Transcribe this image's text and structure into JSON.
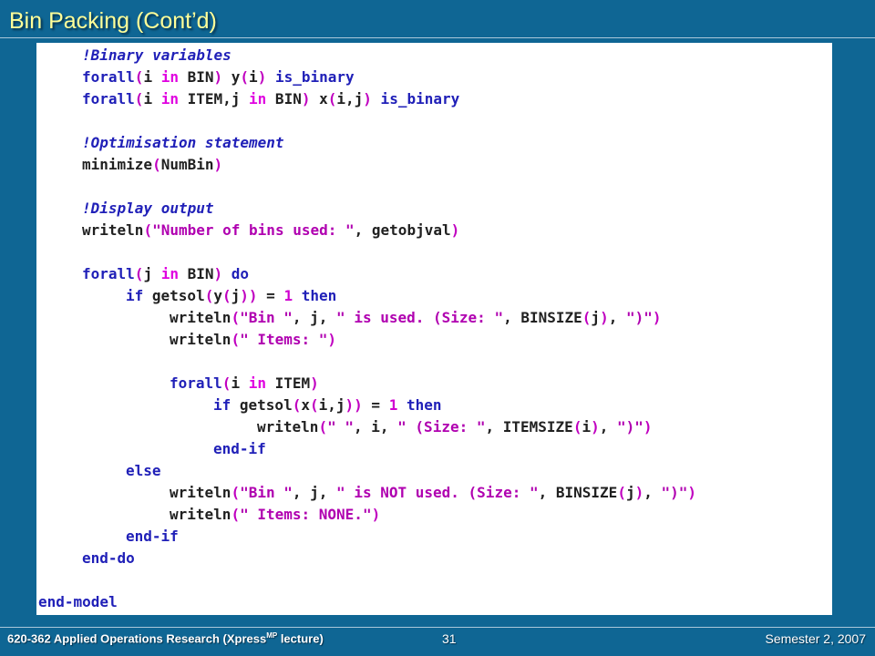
{
  "slide": {
    "title": "Bin Packing (Cont’d)",
    "footer_course_prefix": "620-362 Applied Operations Research (Xpress",
    "footer_course_sup": "MP",
    "footer_course_suffix": " lecture)",
    "page_number": "31",
    "semester": "Semester 2, 2007"
  },
  "code_lines": [
    {
      "indent": 1,
      "tokens": [
        {
          "t": "!Binary variables",
          "c": "com"
        }
      ]
    },
    {
      "indent": 1,
      "tokens": [
        {
          "t": "forall",
          "c": "kw"
        },
        {
          "t": "(",
          "c": "par"
        },
        {
          "t": "i ",
          "c": "id"
        },
        {
          "t": "in",
          "c": "in"
        },
        {
          "t": " BIN",
          "c": "id"
        },
        {
          "t": ")",
          "c": "par"
        },
        {
          "t": " y",
          "c": "id"
        },
        {
          "t": "(",
          "c": "par"
        },
        {
          "t": "i",
          "c": "id"
        },
        {
          "t": ")",
          "c": "par"
        },
        {
          "t": " is_binary",
          "c": "kw"
        }
      ]
    },
    {
      "indent": 1,
      "tokens": [
        {
          "t": "forall",
          "c": "kw"
        },
        {
          "t": "(",
          "c": "par"
        },
        {
          "t": "i ",
          "c": "id"
        },
        {
          "t": "in",
          "c": "in"
        },
        {
          "t": " ITEM,j ",
          "c": "id"
        },
        {
          "t": "in",
          "c": "in"
        },
        {
          "t": " BIN",
          "c": "id"
        },
        {
          "t": ")",
          "c": "par"
        },
        {
          "t": " x",
          "c": "id"
        },
        {
          "t": "(",
          "c": "par"
        },
        {
          "t": "i,j",
          "c": "id"
        },
        {
          "t": ")",
          "c": "par"
        },
        {
          "t": " is_binary",
          "c": "kw"
        }
      ]
    },
    {
      "indent": 0,
      "tokens": []
    },
    {
      "indent": 1,
      "tokens": [
        {
          "t": "!Optimisation statement",
          "c": "com"
        }
      ]
    },
    {
      "indent": 1,
      "tokens": [
        {
          "t": "minimize",
          "c": "id"
        },
        {
          "t": "(",
          "c": "par"
        },
        {
          "t": "NumBin",
          "c": "id"
        },
        {
          "t": ")",
          "c": "par"
        }
      ]
    },
    {
      "indent": 0,
      "tokens": []
    },
    {
      "indent": 1,
      "tokens": [
        {
          "t": "!Display output",
          "c": "com"
        }
      ]
    },
    {
      "indent": 1,
      "tokens": [
        {
          "t": "writeln",
          "c": "id"
        },
        {
          "t": "(",
          "c": "par"
        },
        {
          "t": "\"Number of bins used: \"",
          "c": "str"
        },
        {
          "t": ", getobjval",
          "c": "id"
        },
        {
          "t": ")",
          "c": "par"
        }
      ]
    },
    {
      "indent": 0,
      "tokens": []
    },
    {
      "indent": 1,
      "tokens": [
        {
          "t": "forall",
          "c": "kw"
        },
        {
          "t": "(",
          "c": "par"
        },
        {
          "t": "j ",
          "c": "id"
        },
        {
          "t": "in",
          "c": "in"
        },
        {
          "t": " BIN",
          "c": "id"
        },
        {
          "t": ")",
          "c": "par"
        },
        {
          "t": " do",
          "c": "kw"
        }
      ]
    },
    {
      "indent": 2,
      "tokens": [
        {
          "t": "if",
          "c": "kw"
        },
        {
          "t": " getsol",
          "c": "id"
        },
        {
          "t": "(",
          "c": "par"
        },
        {
          "t": "y",
          "c": "id"
        },
        {
          "t": "(",
          "c": "par"
        },
        {
          "t": "j",
          "c": "id"
        },
        {
          "t": "))",
          "c": "par"
        },
        {
          "t": " = ",
          "c": "id"
        },
        {
          "t": "1",
          "c": "num"
        },
        {
          "t": " then",
          "c": "kw"
        }
      ]
    },
    {
      "indent": 3,
      "tokens": [
        {
          "t": "writeln",
          "c": "id"
        },
        {
          "t": "(",
          "c": "par"
        },
        {
          "t": "\"Bin \"",
          "c": "str"
        },
        {
          "t": ", j, ",
          "c": "id"
        },
        {
          "t": "\" is used. (Size: \"",
          "c": "str"
        },
        {
          "t": ", BINSIZE",
          "c": "id"
        },
        {
          "t": "(",
          "c": "par"
        },
        {
          "t": "j",
          "c": "id"
        },
        {
          "t": ")",
          "c": "par"
        },
        {
          "t": ", ",
          "c": "id"
        },
        {
          "t": "\")\"",
          "c": "str"
        },
        {
          "t": ")",
          "c": "par"
        }
      ]
    },
    {
      "indent": 3,
      "tokens": [
        {
          "t": "writeln",
          "c": "id"
        },
        {
          "t": "(",
          "c": "par"
        },
        {
          "t": "\" Items: \"",
          "c": "str"
        },
        {
          "t": ")",
          "c": "par"
        }
      ]
    },
    {
      "indent": 0,
      "tokens": []
    },
    {
      "indent": 3,
      "tokens": [
        {
          "t": "forall",
          "c": "kw"
        },
        {
          "t": "(",
          "c": "par"
        },
        {
          "t": "i ",
          "c": "id"
        },
        {
          "t": "in",
          "c": "in"
        },
        {
          "t": " ITEM",
          "c": "id"
        },
        {
          "t": ")",
          "c": "par"
        }
      ]
    },
    {
      "indent": 4,
      "tokens": [
        {
          "t": "if",
          "c": "kw"
        },
        {
          "t": " getsol",
          "c": "id"
        },
        {
          "t": "(",
          "c": "par"
        },
        {
          "t": "x",
          "c": "id"
        },
        {
          "t": "(",
          "c": "par"
        },
        {
          "t": "i,j",
          "c": "id"
        },
        {
          "t": "))",
          "c": "par"
        },
        {
          "t": " = ",
          "c": "id"
        },
        {
          "t": "1",
          "c": "num"
        },
        {
          "t": " then",
          "c": "kw"
        }
      ]
    },
    {
      "indent": 5,
      "tokens": [
        {
          "t": "writeln",
          "c": "id"
        },
        {
          "t": "(",
          "c": "par"
        },
        {
          "t": "\" \"",
          "c": "str"
        },
        {
          "t": ", i, ",
          "c": "id"
        },
        {
          "t": "\" (Size: \"",
          "c": "str"
        },
        {
          "t": ", ITEMSIZE",
          "c": "id"
        },
        {
          "t": "(",
          "c": "par"
        },
        {
          "t": "i",
          "c": "id"
        },
        {
          "t": ")",
          "c": "par"
        },
        {
          "t": ", ",
          "c": "id"
        },
        {
          "t": "\")\"",
          "c": "str"
        },
        {
          "t": ")",
          "c": "par"
        }
      ]
    },
    {
      "indent": 4,
      "tokens": [
        {
          "t": "end-if",
          "c": "kw"
        }
      ]
    },
    {
      "indent": 2,
      "tokens": [
        {
          "t": "else",
          "c": "kw"
        }
      ]
    },
    {
      "indent": 3,
      "tokens": [
        {
          "t": "writeln",
          "c": "id"
        },
        {
          "t": "(",
          "c": "par"
        },
        {
          "t": "\"Bin \"",
          "c": "str"
        },
        {
          "t": ", j, ",
          "c": "id"
        },
        {
          "t": "\" is NOT used. (Size: \"",
          "c": "str"
        },
        {
          "t": ", BINSIZE",
          "c": "id"
        },
        {
          "t": "(",
          "c": "par"
        },
        {
          "t": "j",
          "c": "id"
        },
        {
          "t": ")",
          "c": "par"
        },
        {
          "t": ", ",
          "c": "id"
        },
        {
          "t": "\")\"",
          "c": "str"
        },
        {
          "t": ")",
          "c": "par"
        }
      ]
    },
    {
      "indent": 3,
      "tokens": [
        {
          "t": "writeln",
          "c": "id"
        },
        {
          "t": "(",
          "c": "par"
        },
        {
          "t": "\" Items: NONE.\"",
          "c": "str"
        },
        {
          "t": ")",
          "c": "par"
        }
      ]
    },
    {
      "indent": 2,
      "tokens": [
        {
          "t": "end-if",
          "c": "kw"
        }
      ]
    },
    {
      "indent": 1,
      "tokens": [
        {
          "t": "end-do",
          "c": "kw"
        }
      ]
    },
    {
      "indent": 0,
      "tokens": []
    },
    {
      "indent": 0,
      "tokens": [
        {
          "t": "end-model",
          "c": "kw"
        }
      ]
    }
  ],
  "colors": {
    "background": "#0f6694",
    "title": "#ffff99",
    "keyword": "#2020b8",
    "string": "#b000b0"
  }
}
